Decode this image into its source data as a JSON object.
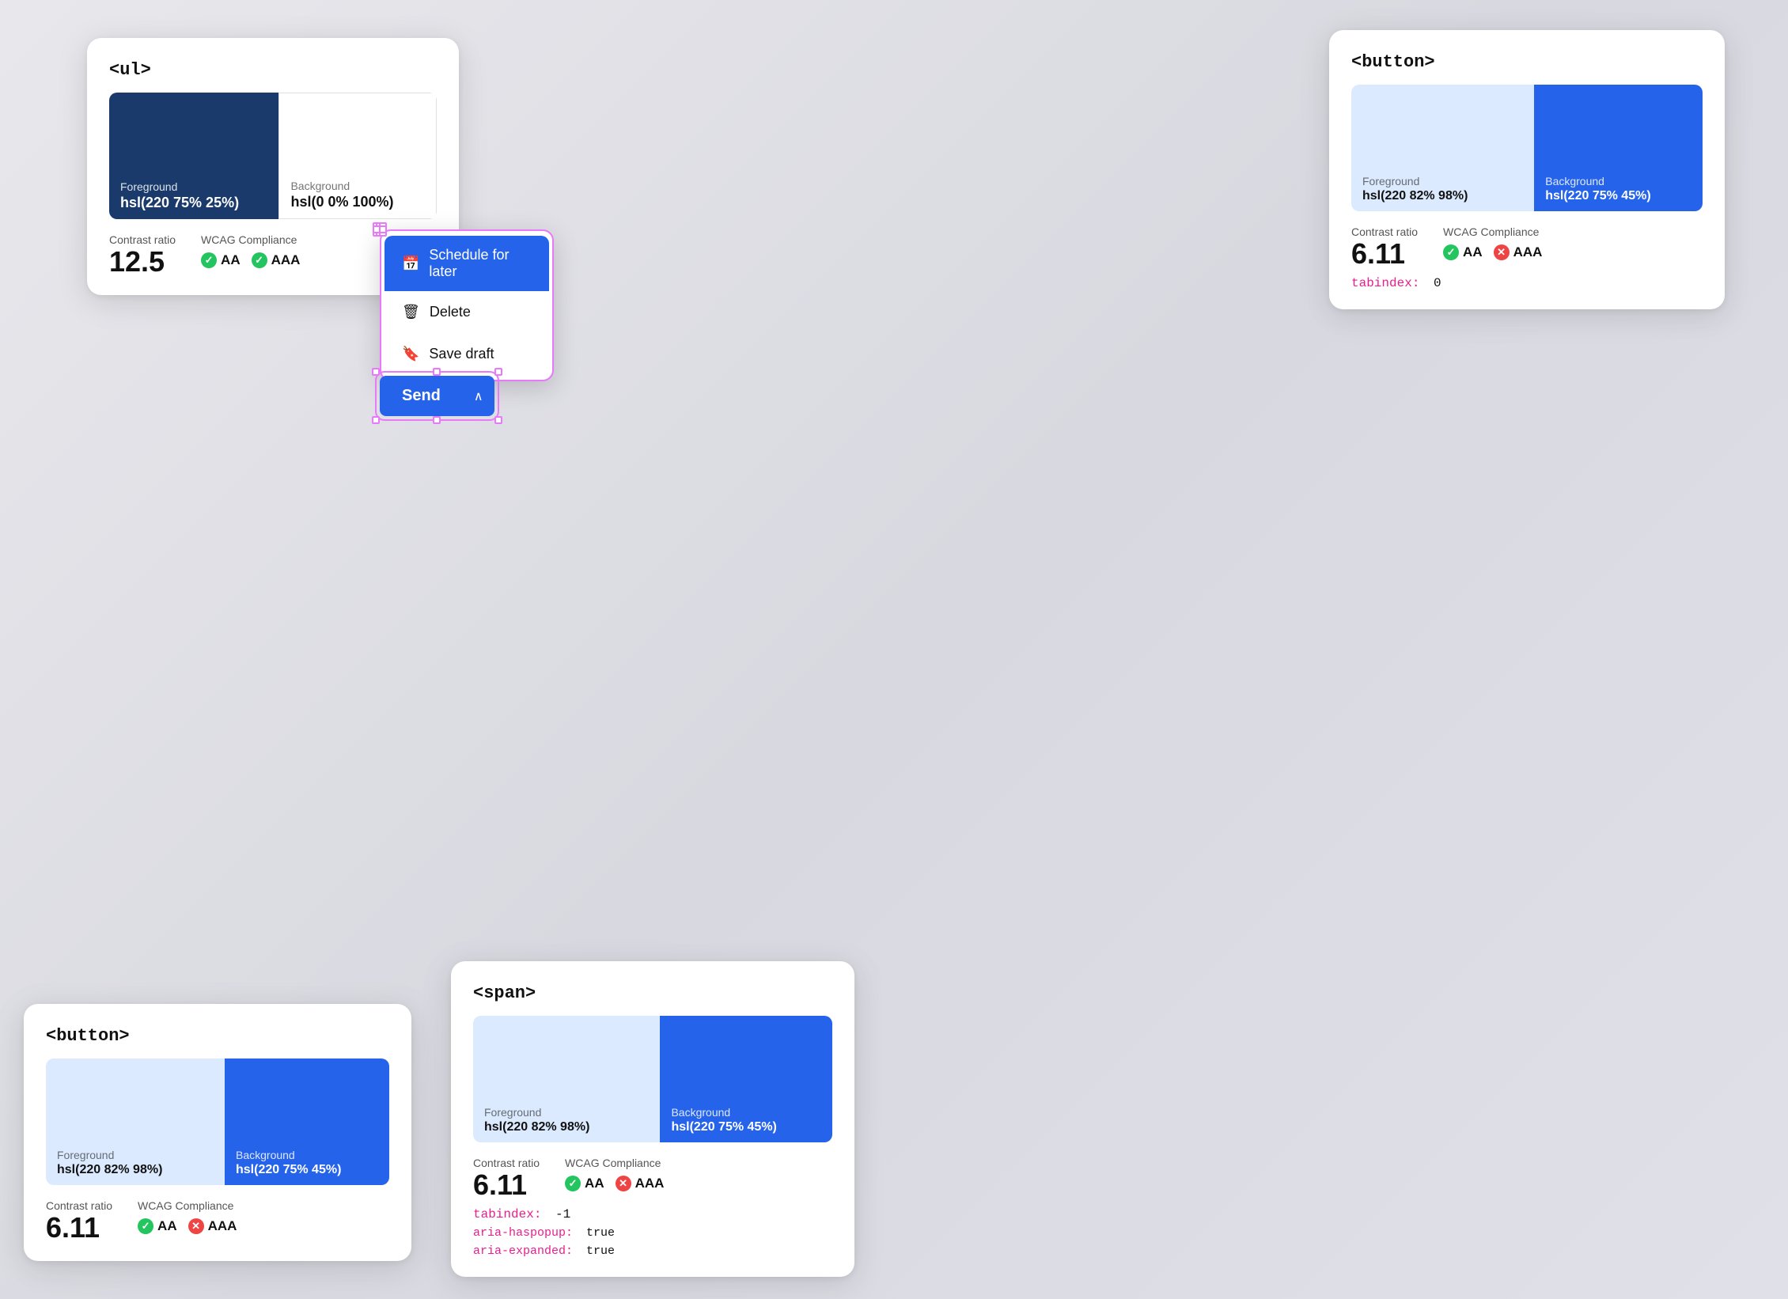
{
  "cards": {
    "ul": {
      "tag": "<ul>",
      "foreground_label": "Foreground",
      "foreground_value": "hsl(220 75% 25%)",
      "background_label": "Background",
      "background_value": "hsl(0 0% 100%)",
      "contrast_label": "Contrast ratio",
      "contrast_value": "12.5",
      "wcag_label": "WCAG Compliance",
      "aa_label": "AA",
      "aaa_label": "AAA",
      "aa_pass": true,
      "aaa_pass": true
    },
    "button_tr": {
      "tag": "<button>",
      "foreground_label": "Foreground",
      "foreground_value": "hsl(220 82% 98%)",
      "background_label": "Background",
      "background_value": "hsl(220 75% 45%)",
      "contrast_label": "Contrast ratio",
      "contrast_value": "6.11",
      "wcag_label": "WCAG Compliance",
      "aa_label": "AA",
      "aaa_label": "AAA",
      "aa_pass": true,
      "aaa_pass": false,
      "tabindex_key": "tabindex:",
      "tabindex_val": "0"
    },
    "button_bl": {
      "tag": "<button>",
      "foreground_label": "Foreground",
      "foreground_value": "hsl(220 82% 98%)",
      "background_label": "Background",
      "background_value": "hsl(220 75% 45%)",
      "contrast_label": "Contrast ratio",
      "contrast_value": "6.11",
      "wcag_label": "WCAG Compliance",
      "aa_label": "AA",
      "aaa_label": "AAA",
      "aa_pass": true,
      "aaa_pass": false
    },
    "span": {
      "tag": "<span>",
      "foreground_label": "Foreground",
      "foreground_value": "hsl(220 82% 98%)",
      "background_label": "Background",
      "background_value": "hsl(220 75% 45%)",
      "contrast_label": "Contrast ratio",
      "contrast_value": "6.11",
      "wcag_label": "WCAG Compliance",
      "aa_label": "AA",
      "aaa_label": "AAA",
      "aa_pass": true,
      "aaa_pass": false,
      "tabindex_key": "tabindex:",
      "tabindex_val": "-1",
      "aria_haspopup_key": "aria-haspopup:",
      "aria_haspopup_val": "true",
      "aria_expanded_key": "aria-expanded:",
      "aria_expanded_val": "true"
    }
  },
  "dropdown": {
    "schedule_label": "Schedule for later",
    "delete_label": "Delete",
    "save_draft_label": "Save draft"
  },
  "send_button": {
    "send_label": "Send",
    "arrow_icon": "∧"
  }
}
